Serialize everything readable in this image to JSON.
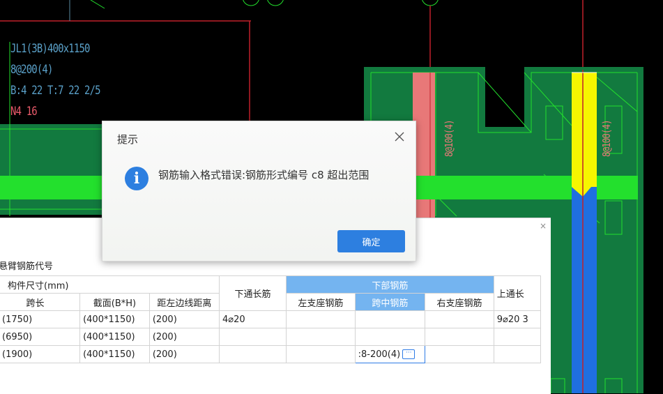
{
  "cad": {
    "beam_label_lines": [
      "JL1(3B)400x1150",
      "8@200(4)",
      "B:4  22  T:7  22 2/5",
      "N4  16"
    ],
    "vertical_label_1": "8@100(4)",
    "vertical_label_2": "8@100(4)"
  },
  "dialog": {
    "title": "提示",
    "message": "钢筋输入格式错误:钢筋形式编号 c8 超出范围",
    "ok_label": "确定",
    "icon": "info-icon",
    "icon_glyph": "i"
  },
  "panel": {
    "close_glyph": "×",
    "section_label": "悬臂钢筋代号",
    "headers": {
      "size_group": "构件尺寸(mm)",
      "span": "跨长",
      "section": "截面(B*H)",
      "left_dist": "距左边线距离",
      "bottom_through": "下通长筋",
      "bottom_group": "下部钢筋",
      "left_support": "左支座钢筋",
      "mid_span": "跨中钢筋",
      "right_support": "右支座钢筋",
      "top_through": "上通长"
    },
    "rows": [
      {
        "span": "(1750)",
        "section": "(400*1150)",
        "left_dist": "(200)",
        "bottom_through": "4⌀20",
        "left_support": "",
        "mid_span": "",
        "right_support": "",
        "top_through": "9⌀20 3"
      },
      {
        "span": "(6950)",
        "section": "(400*1150)",
        "left_dist": "(200)",
        "bottom_through": "",
        "left_support": "",
        "mid_span": "",
        "right_support": "",
        "top_through": ""
      },
      {
        "span": "(1900)",
        "section": "(400*1150)",
        "left_dist": "(200)",
        "bottom_through": "",
        "left_support": "",
        "mid_span": ":8-200(4)",
        "right_support": "",
        "top_through": ""
      }
    ],
    "edit_button_glyph": "···"
  },
  "colors": {
    "cad_background": "#000000",
    "beam_green": "#23e02d",
    "dark_green": "#127a3f",
    "salmon": "#e87878",
    "yellow": "#f6f600",
    "blue": "#1f6fe0",
    "accent": "#2d7fe0"
  }
}
